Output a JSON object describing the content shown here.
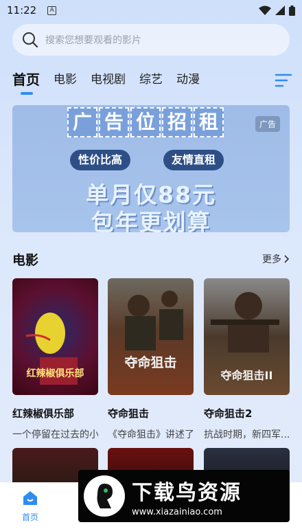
{
  "status": {
    "time": "11:22",
    "notif_letter": "A"
  },
  "search": {
    "placeholder": "搜索您想要观看的影片"
  },
  "tabs": [
    {
      "label": "首页",
      "active": true
    },
    {
      "label": "电影",
      "active": false
    },
    {
      "label": "电视剧",
      "active": false
    },
    {
      "label": "综艺",
      "active": false
    },
    {
      "label": "动漫",
      "active": false
    }
  ],
  "banner": {
    "title_chars": [
      "广",
      "告",
      "位",
      "招",
      "租"
    ],
    "badge": "广告",
    "pill_left": "性价比高",
    "pill_right": "友情直租",
    "line1": "单月仅88元",
    "line2": "包年更划算"
  },
  "section": {
    "title": "电影",
    "more": "更多"
  },
  "movies": [
    {
      "title": "红辣椒俱乐部",
      "desc": "一个停留在过去的小...",
      "poster_text": "红辣椒俱乐部",
      "color": "#6b1220"
    },
    {
      "title": "夺命狙击",
      "desc": "《夺命狙击》讲述了...",
      "poster_text": "夺命狙击",
      "color": "#5a3a28"
    },
    {
      "title": "夺命狙击2",
      "desc": "抗战时期，新四军...",
      "poster_text": "夺命狙击II",
      "color": "#4a3a2c"
    }
  ],
  "bottom_nav": {
    "home_label": "首页"
  },
  "watermark": {
    "name": "下载鸟资源",
    "url": "www.xiazainiao.com"
  },
  "colors": {
    "accent": "#2f8cf0"
  }
}
